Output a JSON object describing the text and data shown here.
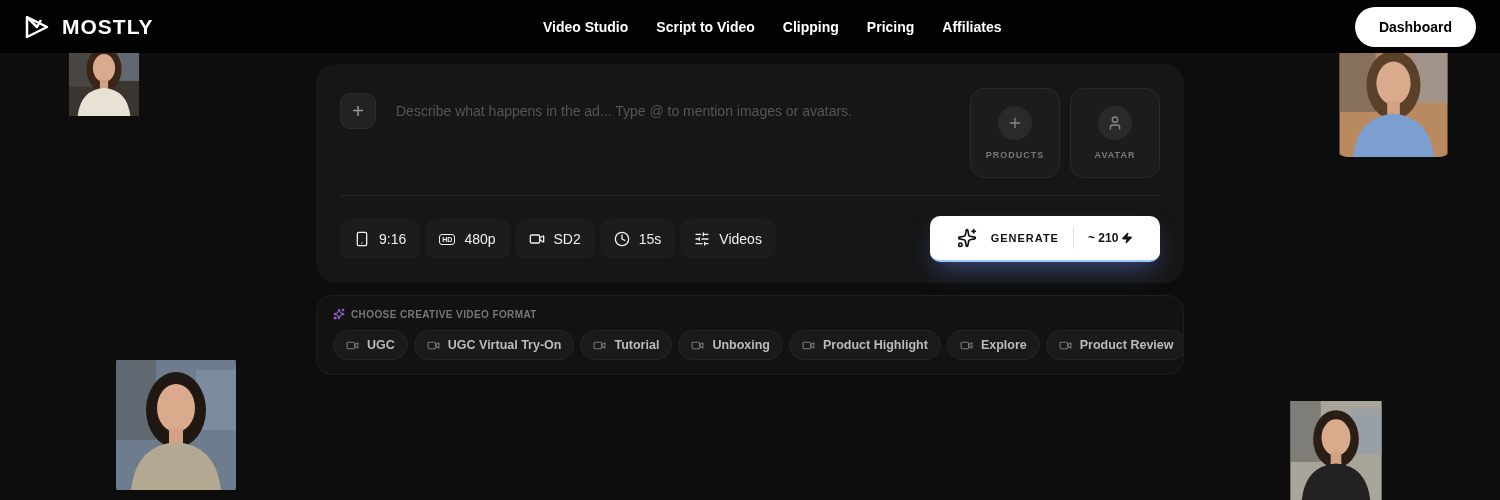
{
  "brand": {
    "name": "MOSTLY"
  },
  "nav": {
    "links": [
      "Video Studio",
      "Script to Video",
      "Clipping",
      "Pricing",
      "Affiliates"
    ],
    "cta": "Dashboard"
  },
  "composer": {
    "attach": "+",
    "prompt": {
      "placeholder": "Describe what happens in the ad... Type @ to mention images or avatars."
    },
    "slots": [
      {
        "kind": "products",
        "label": "PRODUCTS"
      },
      {
        "kind": "avatar",
        "label": "AVATAR"
      }
    ],
    "options": [
      {
        "kind": "phone",
        "label": "9:16"
      },
      {
        "kind": "hd",
        "badge": "HD",
        "label": "480p"
      },
      {
        "kind": "camera",
        "label": "SD2"
      },
      {
        "kind": "clock",
        "label": "15s"
      },
      {
        "kind": "sliders",
        "label": "Videos"
      }
    ],
    "generate": {
      "label": "GENERATE",
      "cost": "~ 210"
    }
  },
  "formats": {
    "title": "CHOOSE CREATIVE VIDEO FORMAT",
    "chips": [
      "UGC",
      "UGC Virtual Try-On",
      "Tutorial",
      "Unboxing",
      "Product Highlight",
      "Explore",
      "Product Review"
    ]
  }
}
